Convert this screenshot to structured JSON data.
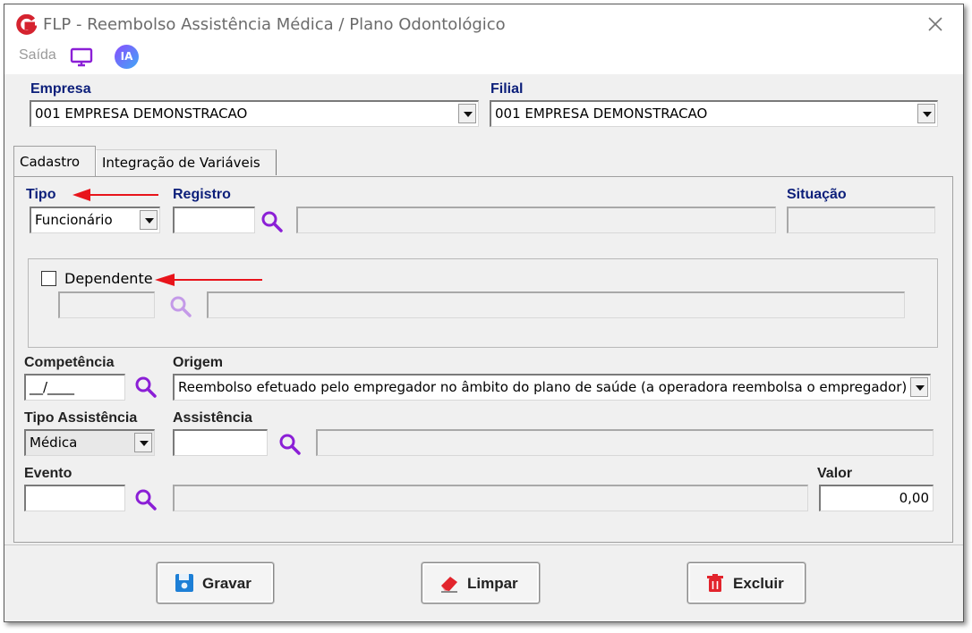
{
  "window": {
    "title": "FLP - Reembolso Assistência Médica / Plano Odontológico",
    "close": "×"
  },
  "toolbar": {
    "saida_label": "Saída",
    "ia_label": "IA"
  },
  "empresa": {
    "label": "Empresa",
    "value": "001 EMPRESA DEMONSTRACAO"
  },
  "filial": {
    "label": "Filial",
    "value": "001 EMPRESA DEMONSTRACAO"
  },
  "tabs": [
    {
      "label": "Cadastro",
      "active": true
    },
    {
      "label": "Integração de Variáveis",
      "active": false
    }
  ],
  "form": {
    "tipo": {
      "label": "Tipo",
      "value": "Funcionário"
    },
    "registro": {
      "label": "Registro",
      "value": "",
      "description": ""
    },
    "situacao": {
      "label": "Situação",
      "value": ""
    },
    "dependente": {
      "label": "Dependente",
      "checked": false,
      "value": "",
      "description": ""
    },
    "competencia": {
      "label": "Competência",
      "value": "__/____"
    },
    "origem": {
      "label": "Origem",
      "value": "Reembolso efetuado pelo empregador no âmbito do plano de saúde (a operadora reembolsa o empregador)"
    },
    "tipo_assistencia": {
      "label": "Tipo Assistência",
      "value": "Médica"
    },
    "assistencia": {
      "label": "Assistência",
      "value": "",
      "description": ""
    },
    "evento": {
      "label": "Evento",
      "value": "",
      "description": ""
    },
    "valor": {
      "label": "Valor",
      "value": "0,00"
    }
  },
  "buttons": {
    "gravar": "Gravar",
    "limpar": "Limpar",
    "excluir": "Excluir"
  },
  "colors": {
    "label_blue": "#0c1f7a",
    "accent_purple": "#8b1fd6",
    "annotation_red": "#e8141b",
    "logo_red": "#d5232f"
  },
  "icons": [
    "app-logo-icon",
    "close-icon",
    "monitor-icon",
    "ia-icon",
    "search-icon",
    "save-icon",
    "eraser-icon",
    "trash-icon",
    "dropdown-arrow-icon"
  ]
}
